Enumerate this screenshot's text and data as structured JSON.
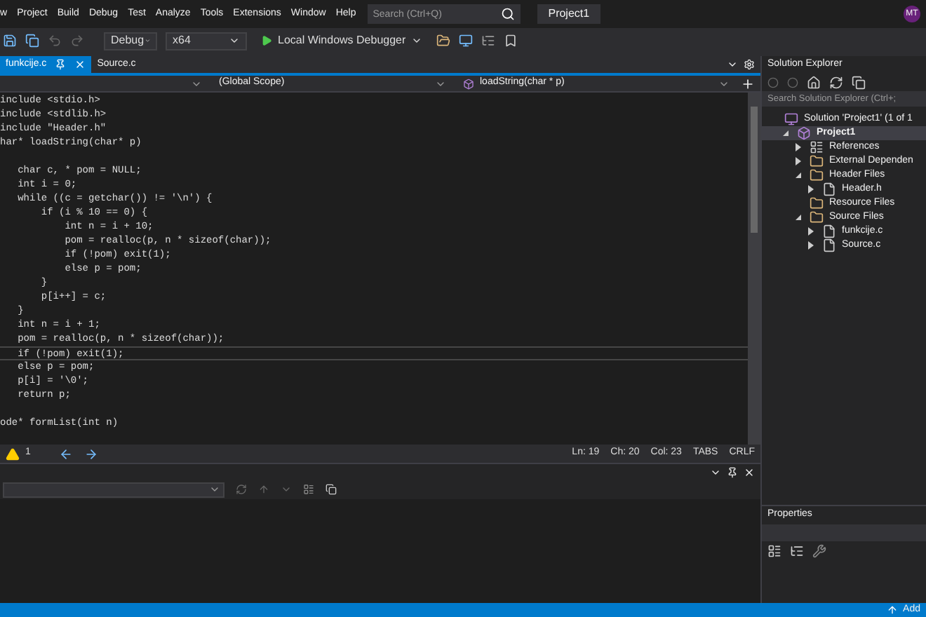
{
  "menu": [
    "w",
    "Project",
    "Build",
    "Debug",
    "Test",
    "Analyze",
    "Tools",
    "Extensions",
    "Window",
    "Help"
  ],
  "search": {
    "placeholder": "Search (Ctrl+Q)"
  },
  "project_title": "Project1",
  "avatar": "MT",
  "toolbar": {
    "configuration": "Debug",
    "platform": "x64",
    "run": "Local Windows Debugger"
  },
  "tabs": [
    {
      "label": "funkcije.c",
      "selected": true
    },
    {
      "label": "Source.c",
      "selected": false
    }
  ],
  "nav": {
    "scope": "(Global Scope)",
    "member": "loadString(char * p)"
  },
  "code": [
    {
      "text": "include <stdio.h>"
    },
    {
      "text": "include <stdlib.h>"
    },
    {
      "text": "include \"Header.h\""
    },
    {
      "text": "har* loadString(char* p)"
    },
    {
      "text": "   char c, * pom = NULL;",
      "gap_before": true
    },
    {
      "text": "   int i = 0;"
    },
    {
      "text": "   while ((c = getchar()) != '\\n') {"
    },
    {
      "text": "       if (i % 10 == 0) {"
    },
    {
      "text": "           int n = i + 10;"
    },
    {
      "text": "           pom = realloc(p, n * sizeof(char));"
    },
    {
      "text": "           if (!pom) exit(1);"
    },
    {
      "text": "           else p = pom;"
    },
    {
      "text": "       }"
    },
    {
      "text": "       p[i++] = c;"
    },
    {
      "text": "   }"
    },
    {
      "text": "   int n = i + 1;"
    },
    {
      "text": "   pom = realloc(p, n * sizeof(char));"
    },
    {
      "text": "   if (!pom) exit(1);",
      "current": true
    },
    {
      "text": "   else p = pom;"
    },
    {
      "text": "   p[i] = '\\0';"
    },
    {
      "text": "   return p;"
    },
    {
      "text": "ode* formList(int n)",
      "gap_before": true
    }
  ],
  "editor_status": {
    "warnings": "1",
    "line": "Ln: 19",
    "char": "Ch: 20",
    "col": "Col: 23",
    "indent": "TABS",
    "eol": "CRLF"
  },
  "solution_explorer": {
    "title": "Solution Explorer",
    "search": {
      "placeholder": "Search Solution Explorer (Ctrl+;"
    },
    "tree": [
      {
        "label": "Solution 'Project1' (1 of 1",
        "kind": "solution",
        "selected": false,
        "children": [
          {
            "label": "Project1",
            "kind": "project",
            "expanded": true,
            "selected": true,
            "children": [
              {
                "label": "References",
                "kind": "references",
                "expanded": false,
                "selected": false
              },
              {
                "label": "External Dependen",
                "kind": "external",
                "expanded": false,
                "selected": false
              },
              {
                "label": "Header Files",
                "kind": "folder",
                "expanded": true,
                "selected": false,
                "children": [
                  {
                    "label": "Header.h",
                    "kind": "file",
                    "expanded": false,
                    "selected": false
                  }
                ]
              },
              {
                "label": "Resource Files",
                "kind": "folder",
                "selected": false
              },
              {
                "label": "Source Files",
                "kind": "folder",
                "expanded": true,
                "selected": false,
                "children": [
                  {
                    "label": "funkcije.c",
                    "kind": "file",
                    "expanded": false,
                    "selected": false
                  },
                  {
                    "label": "Source.c",
                    "kind": "file",
                    "expanded": false,
                    "selected": false
                  }
                ]
              }
            ]
          }
        ]
      }
    ]
  },
  "properties": {
    "title": "Properties"
  },
  "status_bar": {
    "action": "Add"
  }
}
